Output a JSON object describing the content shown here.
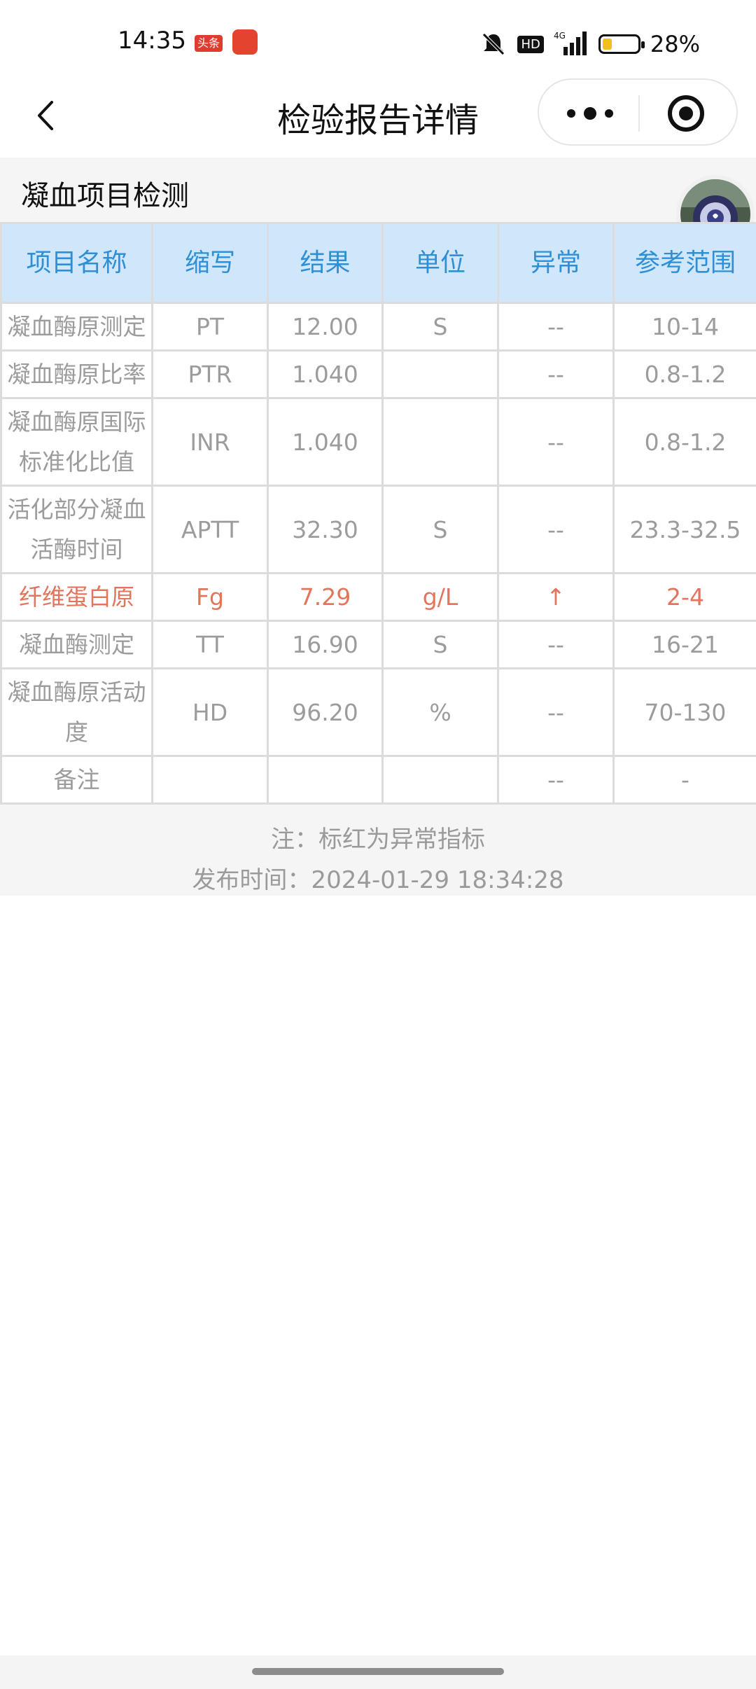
{
  "status_bar": {
    "time": "14:35",
    "news_badge": "头条",
    "hd": "HD",
    "battery_text": "28%",
    "battery_level": 0.28,
    "battery_color": "#f2c01d"
  },
  "nav": {
    "title": "检验报告详情"
  },
  "section": {
    "title": "凝血项目检测"
  },
  "table": {
    "headers": [
      "项目名称",
      "缩写",
      "结果",
      "单位",
      "异常",
      "参考范围"
    ],
    "rows": [
      {
        "name": "凝血酶原测定",
        "abbr": "PT",
        "result": "12.00",
        "unit": "S",
        "abnormal": "--",
        "range": "10-14"
      },
      {
        "name": "凝血酶原比率",
        "abbr": "PTR",
        "result": "1.040",
        "unit": "",
        "abnormal": "--",
        "range": "0.8-1.2"
      },
      {
        "name": "凝血酶原国际标准化比值",
        "abbr": "INR",
        "result": "1.040",
        "unit": "",
        "abnormal": "--",
        "range": "0.8-1.2"
      },
      {
        "name": "活化部分凝血活酶时间",
        "abbr": "APTT",
        "result": "32.30",
        "unit": "S",
        "abnormal": "--",
        "range": "23.3-32.5"
      },
      {
        "name": "纤维蛋白原",
        "abbr": "Fg",
        "result": "7.29",
        "unit": "g/L",
        "abnormal": "↑",
        "range": "2-4"
      },
      {
        "name": "凝血酶测定",
        "abbr": "TT",
        "result": "16.90",
        "unit": "S",
        "abnormal": "--",
        "range": "16-21"
      },
      {
        "name": "凝血酶原活动度",
        "abbr": "HD",
        "result": "96.20",
        "unit": "%",
        "abnormal": "--",
        "range": "70-130"
      },
      {
        "name": "备注",
        "abbr": "",
        "result": "",
        "unit": "",
        "abnormal": "--",
        "range": "-"
      }
    ],
    "header_bg": "#cfe6fb",
    "header_color": "#2f8fd5",
    "abnormal_color": "#e2755c"
  },
  "footer": {
    "note": "注：标红为异常指标",
    "publish_time": "发布时间：2024-01-29 18:34:28"
  },
  "icons": [
    "back-icon",
    "more-icon",
    "target-icon",
    "avatar",
    "mute-icon",
    "signal-icon",
    "battery-icon"
  ]
}
